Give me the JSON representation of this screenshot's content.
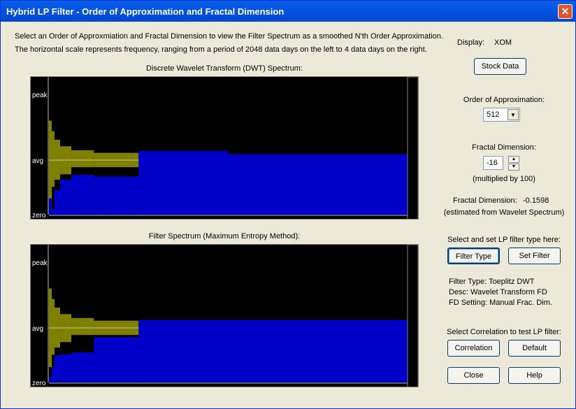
{
  "window": {
    "title": "Hybrid LP Filter - Order of Approximation and Fractal Dimension",
    "close": "✕"
  },
  "intro": [
    "Select an Order of Approxmiation and Fractal Dimension to view the Filter Spectrum as a smoothed N'th Order Approximation.",
    "The horizontal scale represents frequency, ranging from a period of 2048 data days on the left to 4 data days on the right."
  ],
  "side": {
    "display_label": "Display:",
    "display_value": "XOM",
    "stock_button": "Stock Data",
    "order_label": "Order of Approximation:",
    "order_value": "512",
    "fd_label": "Fractal Dimension:",
    "fd_value": "-16",
    "fd_note": "(multiplied by 100)",
    "fd_est_label": "Fractal Dimension:",
    "fd_est_value": "-0.1598",
    "fd_est_note": "(estimated from Wavelet Spectrum)",
    "filter_prompt": "Select and set LP filter type here:",
    "filter_type_button": "Filter Type",
    "set_filter_button": "Set Filter",
    "filter_type": "Filter Type:  Toeplitz DWT",
    "desc": "Desc:  Wavelet Transform FD",
    "fd_setting": "FD Setting:  Manual Frac. Dim.",
    "corr_prompt": "Select Correlation to test LP filter:",
    "correlation_button": "Correlation",
    "default_button": "Default",
    "close_button": "Close",
    "help_button": "Help"
  },
  "colors": {
    "band": "#808000",
    "spectrum": "#0000c8",
    "avg_line": "#c8c8a0",
    "background": "#000000"
  },
  "chart_data": [
    {
      "type": "bar",
      "title": "Discrete Wavelet Transform (DWT) Spectrum:",
      "y_tick_labels": [
        "peak",
        "avg",
        "zero"
      ],
      "x_range_period_days": [
        2048,
        4
      ],
      "segment_end_fraction": [
        0.0078,
        0.0156,
        0.03125,
        0.0625,
        0.125,
        0.25,
        0.5,
        1
      ],
      "band_upper": [
        1.6,
        1.44,
        1.31,
        1.21,
        1.15,
        1.11,
        null,
        null
      ],
      "band_lower": [
        0.28,
        0.51,
        0.64,
        0.74,
        0.87,
        0.87,
        null,
        null
      ],
      "spectrum": [
        0.3,
        0.09,
        0.45,
        0.64,
        0.73,
        0.7,
        1.14,
        1.09
      ]
    },
    {
      "type": "bar",
      "title": "Filter Spectrum (Maximum Entropy Method):",
      "y_tick_labels": [
        "peak",
        "avg",
        "zero"
      ],
      "x_range_period_days": [
        2048,
        4
      ],
      "segment_end_fraction": [
        0.0078,
        0.0156,
        0.03125,
        0.0625,
        0.125,
        0.25,
        0.5,
        1
      ],
      "band_upper": [
        1.6,
        1.44,
        1.31,
        1.21,
        1.15,
        1.11,
        null,
        null
      ],
      "band_lower": [
        0.28,
        0.51,
        0.64,
        0.74,
        0.87,
        0.87,
        null,
        null
      ],
      "spectrum": [
        0.1,
        0.3,
        0.5,
        0.52,
        0.55,
        0.83,
        1.12,
        1.12
      ]
    }
  ]
}
